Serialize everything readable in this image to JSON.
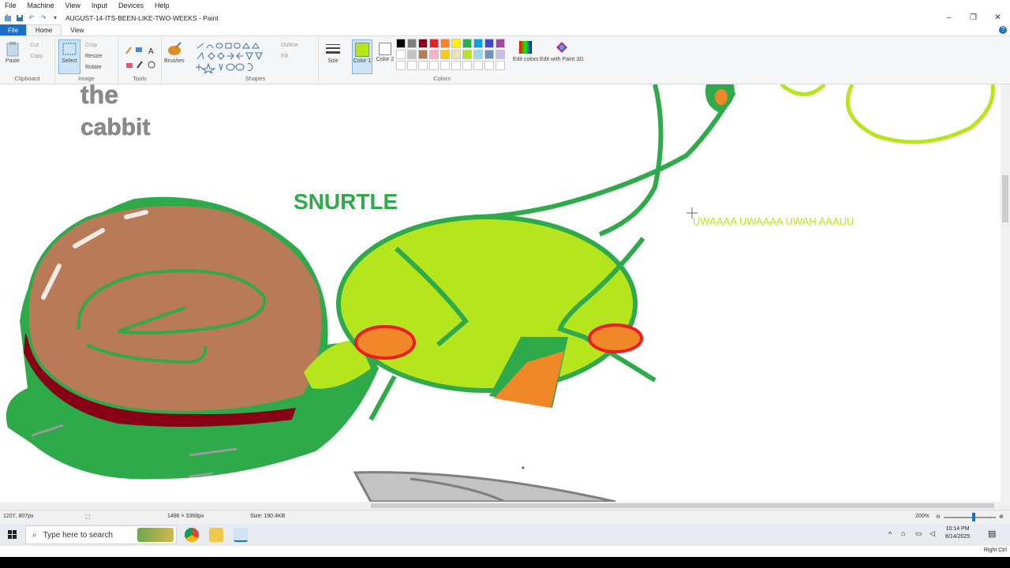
{
  "vm_menu": [
    "File",
    "Machine",
    "View",
    "Input",
    "Devices",
    "Help"
  ],
  "title": "AUGUST-14-ITS-BEEN-LIKE-TWO-WEEKS - Paint",
  "window_controls": [
    "–",
    "❐",
    "✕"
  ],
  "ribbon_tabs": [
    "File",
    "Home",
    "View"
  ],
  "ribbon": {
    "clipboard": {
      "label": "Clipboard",
      "paste": "Paste",
      "cut": "Cut",
      "copy": "Copy"
    },
    "image": {
      "label": "Image",
      "select": "Select",
      "crop": "Crop",
      "resize": "Resize",
      "rotate": "Rotate"
    },
    "tools": {
      "label": "Tools"
    },
    "brushes": "Brushes",
    "shapes": {
      "label": "Shapes",
      "outline": "Outline",
      "fill": "Fill"
    },
    "size": "Size",
    "color1": "Color 1",
    "color2": "Color 2",
    "colors": {
      "label": "Colors",
      "edit": "Edit colors",
      "paint3d": "Edit with Paint 3D"
    },
    "palette": [
      "#000000",
      "#7f7f7f",
      "#880015",
      "#ed1c24",
      "#ff7f27",
      "#fff200",
      "#22b14c",
      "#00a2e8",
      "#3f48cc",
      "#a349a4",
      "#ffffff",
      "#c3c3c3",
      "#b97a57",
      "#ffaec9",
      "#ffc90e",
      "#efe4b0",
      "#b5e61d",
      "#99d9ea",
      "#7092be",
      "#c8bfe7",
      "#ffffff",
      "#ffffff",
      "#ffffff",
      "#ffffff",
      "#ffffff",
      "#ffffff",
      "#ffffff",
      "#ffffff",
      "#ffffff",
      "#ffffff"
    ]
  },
  "canvas": {
    "text_the": "the",
    "text_cabbit": "cabbit",
    "text_snurtle": "SNURTLE",
    "text_scream": "UWAAAA UWAAAA UWAH AAAUU"
  },
  "status": {
    "cursor_pos": "1207, 807px",
    "dimensions": "1496 × 3368px",
    "size": "Size: 190.4KB",
    "zoom": "200%"
  },
  "taskbar": {
    "search_placeholder": "Type here to search",
    "time": "10:14 PM",
    "date": "8/14/2025"
  },
  "vm_status": "Right Ctrl"
}
